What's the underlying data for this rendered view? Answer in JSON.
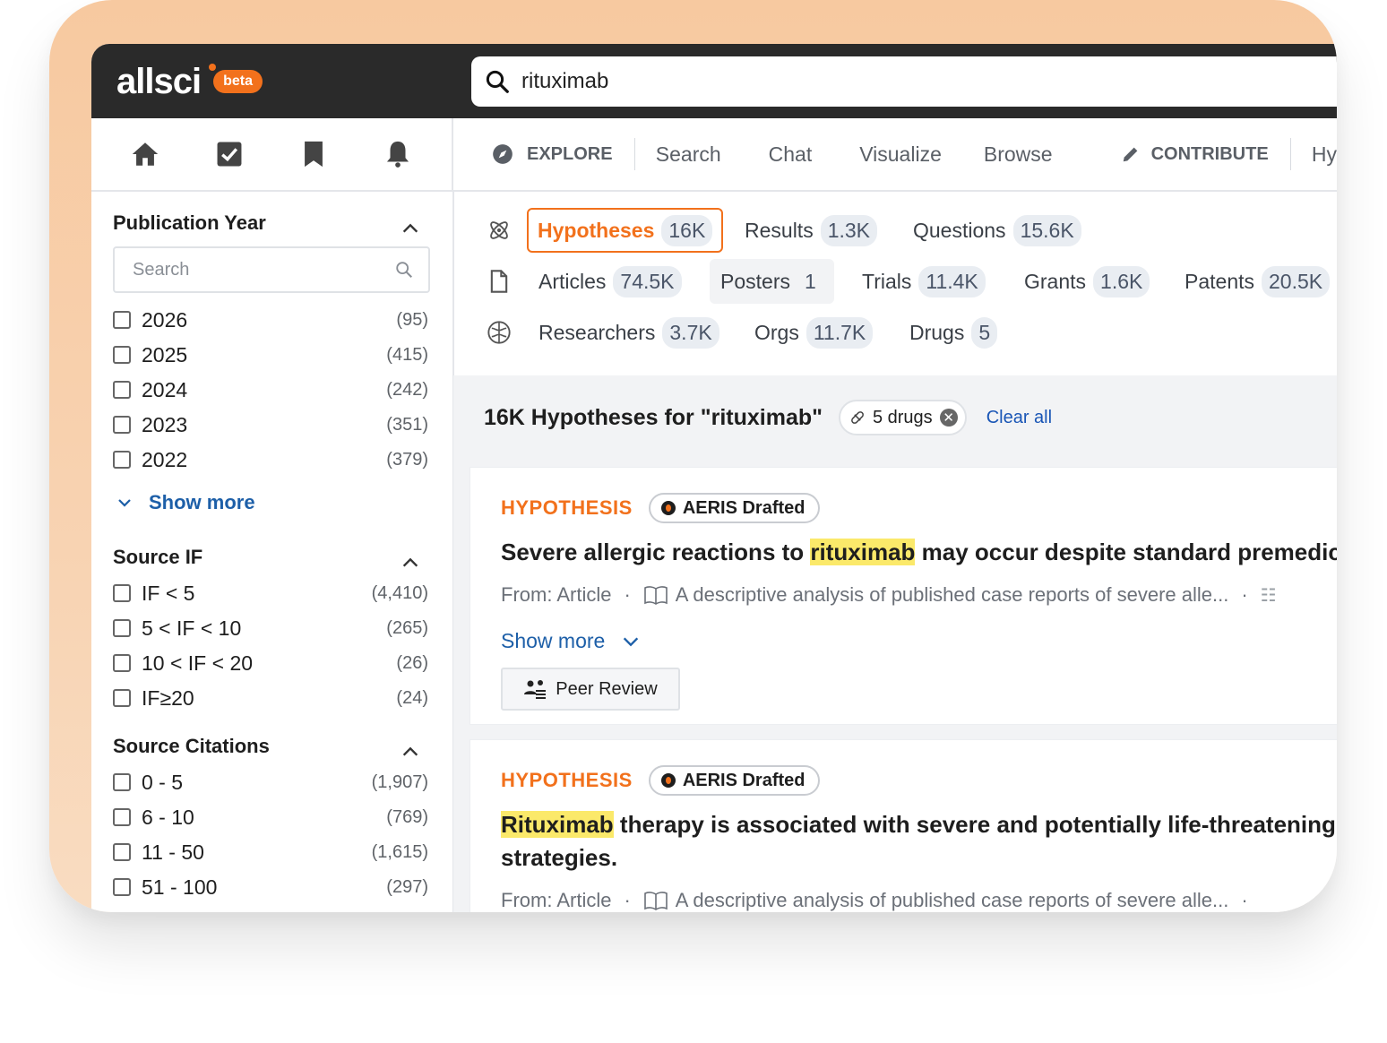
{
  "brand": {
    "name": "allsci",
    "badge": "beta"
  },
  "search": {
    "query": "rituximab"
  },
  "left_nav": [
    "home-icon",
    "tasks-icon",
    "bookmark-icon",
    "bell-icon"
  ],
  "tabs": {
    "explore": "EXPLORE",
    "items": [
      "Search",
      "Chat",
      "Visualize",
      "Browse"
    ],
    "contribute": "CONTRIBUTE",
    "extra": "Hy"
  },
  "categories": {
    "row1": [
      {
        "name": "Hypotheses",
        "count": "16K",
        "active": true
      },
      {
        "name": "Results",
        "count": "1.3K"
      },
      {
        "name": "Questions",
        "count": "15.6K"
      }
    ],
    "row2": [
      {
        "name": "Articles",
        "count": "74.5K"
      },
      {
        "name": "Posters",
        "count": "1"
      },
      {
        "name": "Trials",
        "count": "11.4K"
      },
      {
        "name": "Grants",
        "count": "1.6K"
      },
      {
        "name": "Patents",
        "count": "20.5K"
      }
    ],
    "row3": [
      {
        "name": "Researchers",
        "count": "3.7K"
      },
      {
        "name": "Orgs",
        "count": "11.7K"
      },
      {
        "name": "Drugs",
        "count": "5"
      }
    ]
  },
  "filters": {
    "pub_year": {
      "title": "Publication Year",
      "search_placeholder": "Search",
      "options": [
        {
          "label": "2026",
          "count": "(95)"
        },
        {
          "label": "2025",
          "count": "(415)"
        },
        {
          "label": "2024",
          "count": "(242)"
        },
        {
          "label": "2023",
          "count": "(351)"
        },
        {
          "label": "2022",
          "count": "(379)"
        }
      ],
      "show_more": "Show more"
    },
    "source_if": {
      "title": "Source IF",
      "options": [
        {
          "label": "IF < 5",
          "count": "(4,410)"
        },
        {
          "label": "5 < IF < 10",
          "count": "(265)"
        },
        {
          "label": "10 < IF < 20",
          "count": "(26)"
        },
        {
          "label": "IF≥20",
          "count": "(24)"
        }
      ]
    },
    "source_citations": {
      "title": "Source Citations",
      "options": [
        {
          "label": "0 - 5",
          "count": "(1,907)"
        },
        {
          "label": "6 - 10",
          "count": "(769)"
        },
        {
          "label": "11 - 50",
          "count": "(1,615)"
        },
        {
          "label": "51 - 100",
          "count": "(297)"
        }
      ]
    }
  },
  "results": {
    "heading": "16K Hypotheses for \"rituximab\"",
    "filter_pill": "5 drugs",
    "clear_all": "Clear all",
    "cards": [
      {
        "kind": "HYPOTHESIS",
        "badge": "AERIS Drafted",
        "title_pre": "Severe allergic reactions to ",
        "title_hl": "rituximab",
        "title_post": " may occur despite standard premedicat",
        "from": "From: Article",
        "source": "A descriptive analysis of published case reports of severe alle...",
        "show_more": "Show more",
        "action": "Peer Review"
      },
      {
        "kind": "HYPOTHESIS",
        "badge": "AERIS Drafted",
        "title_hl": "Rituximab",
        "title_post": " therapy is associated with severe and potentially life-threatening al",
        "title_line2": "strategies.",
        "from": "From: Article",
        "source": "A descriptive analysis of published case reports of severe alle..."
      }
    ]
  },
  "colors": {
    "accent": "#f2711c",
    "link": "#1d5fa8",
    "highlight": "#fbe96a",
    "topbar": "#2a2a2a"
  }
}
